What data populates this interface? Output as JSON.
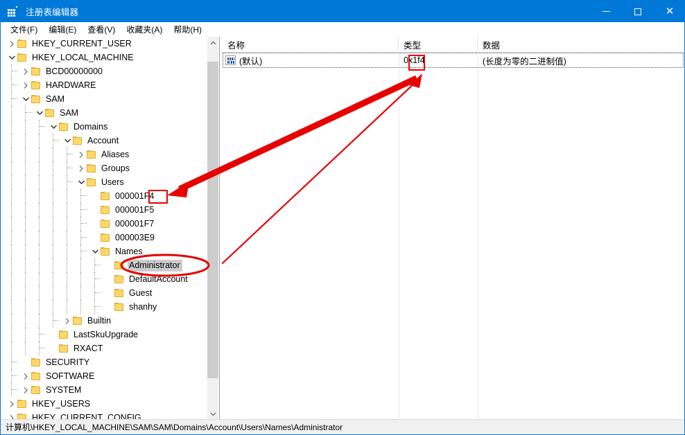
{
  "window": {
    "title": "注册表编辑器",
    "icon": "registry-grid-icon",
    "accent_color": "#0078d7",
    "minimize_label": "最小化",
    "maximize_label": "最大化",
    "close_label": "关闭"
  },
  "menubar": {
    "items": [
      {
        "label": "文件(F)",
        "text": "文件(",
        "accel": "F",
        "tail": ")"
      },
      {
        "label": "编辑(E)",
        "text": "编辑(",
        "accel": "E",
        "tail": ")"
      },
      {
        "label": "查看(V)",
        "text": "查看(",
        "accel": "V",
        "tail": ")"
      },
      {
        "label": "收藏夹(A)",
        "text": "收藏夹(",
        "accel": "A",
        "tail": ")"
      },
      {
        "label": "帮助(H)",
        "text": "帮助(",
        "accel": "H",
        "tail": ")"
      }
    ]
  },
  "tree": {
    "rows": [
      {
        "label": "HKEY_CURRENT_USER",
        "depth": 1,
        "state": "collapsed",
        "selected": false
      },
      {
        "label": "HKEY_LOCAL_MACHINE",
        "depth": 1,
        "state": "expanded",
        "selected": false
      },
      {
        "label": "BCD00000000",
        "depth": 2,
        "state": "collapsed",
        "selected": false
      },
      {
        "label": "HARDWARE",
        "depth": 2,
        "state": "collapsed",
        "selected": false
      },
      {
        "label": "SAM",
        "depth": 2,
        "state": "expanded",
        "selected": false
      },
      {
        "label": "SAM",
        "depth": 3,
        "state": "expanded",
        "selected": false
      },
      {
        "label": "Domains",
        "depth": 4,
        "state": "expanded",
        "selected": false
      },
      {
        "label": "Account",
        "depth": 5,
        "state": "expanded",
        "selected": false
      },
      {
        "label": "Aliases",
        "depth": 6,
        "state": "collapsed",
        "selected": false
      },
      {
        "label": "Groups",
        "depth": 6,
        "state": "collapsed",
        "selected": false
      },
      {
        "label": "Users",
        "depth": 6,
        "state": "expanded",
        "selected": false
      },
      {
        "label": "000001F4",
        "depth": 7,
        "state": "leaf",
        "selected": false
      },
      {
        "label": "000001F5",
        "depth": 7,
        "state": "leaf",
        "selected": false
      },
      {
        "label": "000001F7",
        "depth": 7,
        "state": "leaf",
        "selected": false
      },
      {
        "label": "000003E9",
        "depth": 7,
        "state": "leaf",
        "selected": false
      },
      {
        "label": "Names",
        "depth": 7,
        "state": "expanded",
        "selected": false
      },
      {
        "label": "Administrator",
        "depth": 8,
        "state": "leaf",
        "selected": true
      },
      {
        "label": "DefaultAccount",
        "depth": 8,
        "state": "leaf",
        "selected": false
      },
      {
        "label": "Guest",
        "depth": 8,
        "state": "leaf",
        "selected": false
      },
      {
        "label": "shanhy",
        "depth": 8,
        "state": "leaf",
        "selected": false
      },
      {
        "label": "Builtin",
        "depth": 5,
        "state": "collapsed",
        "selected": false
      },
      {
        "label": "LastSkuUpgrade",
        "depth": 4,
        "state": "leaf",
        "selected": false
      },
      {
        "label": "RXACT",
        "depth": 4,
        "state": "leaf",
        "selected": false
      },
      {
        "label": "SECURITY",
        "depth": 2,
        "state": "leaf",
        "selected": false
      },
      {
        "label": "SOFTWARE",
        "depth": 2,
        "state": "collapsed",
        "selected": false
      },
      {
        "label": "SYSTEM",
        "depth": 2,
        "state": "collapsed",
        "selected": false
      },
      {
        "label": "HKEY_USERS",
        "depth": 1,
        "state": "collapsed",
        "selected": false
      },
      {
        "label": "HKEY_CURRENT_CONFIG",
        "depth": 1,
        "state": "collapsed",
        "selected": false
      }
    ],
    "scrollbar": {
      "up_arrow": "▲",
      "down_arrow": "▼"
    }
  },
  "list": {
    "columns": [
      {
        "label": "名称"
      },
      {
        "label": "类型"
      },
      {
        "label": "数据"
      }
    ],
    "rows": [
      {
        "icon": "binary-value-icon",
        "name": "(默认)",
        "type": "0x1f4",
        "data": "(长度为零的二进制值)",
        "selected": true
      }
    ]
  },
  "statusbar": {
    "path": "计算机\\HKEY_LOCAL_MACHINE\\SAM\\SAM\\Domains\\Account\\Users\\Names\\Administrator"
  },
  "annotations": {
    "color": "#e60000",
    "highlight_tree_key": "000001F4",
    "highlight_list_type": "0x1f4",
    "circled_tree_item": "Administrator",
    "arrow_count": 2
  }
}
